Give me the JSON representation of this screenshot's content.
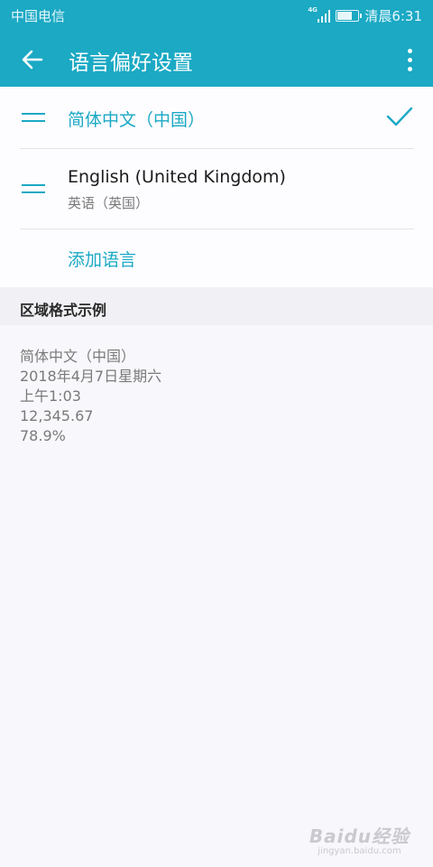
{
  "status_bar": {
    "carrier": "中国电信",
    "network_tag": "4G",
    "time": "清晨6:31"
  },
  "app_bar": {
    "title": "语言偏好设置",
    "back_icon": "arrow-left-icon",
    "more_icon": "more-vertical-icon"
  },
  "languages": [
    {
      "label": "简体中文（中国）",
      "selected": true
    },
    {
      "label": "English (United Kingdom)",
      "sublabel": "英语（英国）",
      "selected": false
    }
  ],
  "add_language_label": "添加语言",
  "region_section": {
    "header": "区域格式示例",
    "examples": [
      "简体中文（中国）",
      "2018年4月7日星期六",
      "上午1:03",
      "12,345.67",
      "78.9%"
    ]
  },
  "watermark": {
    "logo": "Baidu经验",
    "url": "jingyan.baidu.com"
  },
  "colors": {
    "accent": "#1ba9c4",
    "background": "#f8f7fb"
  }
}
